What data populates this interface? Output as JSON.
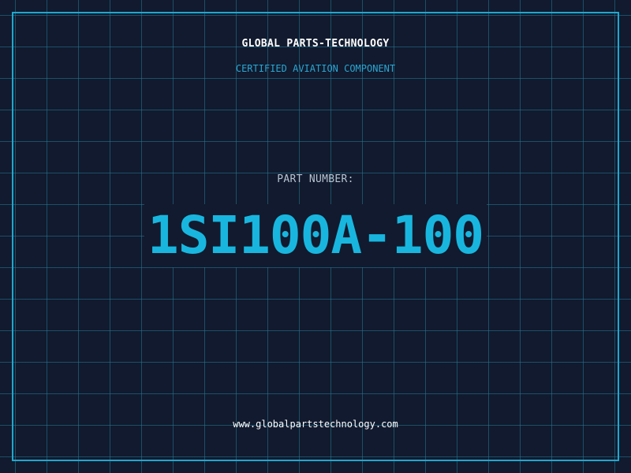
{
  "header": {
    "company": "GLOBAL PARTS-TECHNOLOGY",
    "subtitle": "CERTIFIED AVIATION COMPONENT"
  },
  "part": {
    "label": "PART NUMBER:",
    "number": "1SI100A-100"
  },
  "footer": {
    "website": "www.globalpartstechnology.com"
  },
  "colors": {
    "background": "#111a2e",
    "grid": "#267a96",
    "frame": "#1fa8cf",
    "accent": "#18b6df"
  }
}
